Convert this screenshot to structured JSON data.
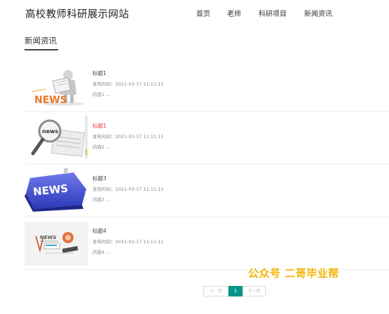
{
  "header": {
    "site_title": "高校教师科研展示网站",
    "nav": [
      "首页",
      "老师",
      "科研项目",
      "新闻资讯"
    ]
  },
  "section": {
    "title": "新闻资讯"
  },
  "news": [
    {
      "title": "标题1",
      "time": "发布时间：2021-03-17 11:11:11",
      "content": "内容1 ...",
      "image_icon": "news-reader-figure",
      "highlighted": false
    },
    {
      "title": "标题1",
      "time": "发布时间：2021-03-17 11:11:11",
      "content": "内容2 ...",
      "image_icon": "magnifier-over-newspaper",
      "highlighted": true
    },
    {
      "title": "标题3",
      "time": "发布时间：2021-03-17 11:11:11",
      "content": "内容3 ...",
      "image_icon": "news-keyboard-key",
      "highlighted": false
    },
    {
      "title": "标题4",
      "time": "发布时间：2021-03-17 11:11:11",
      "content": "内容4 ...",
      "image_icon": "news-sketch-illustration",
      "highlighted": false
    }
  ],
  "watermark": "公众号 二哥毕业帮",
  "pagination": {
    "prev": "上一页",
    "current": "1",
    "next": "下一页"
  },
  "colors": {
    "accent": "#009688",
    "highlight": "#e4393c",
    "watermark": "#f4b400"
  }
}
